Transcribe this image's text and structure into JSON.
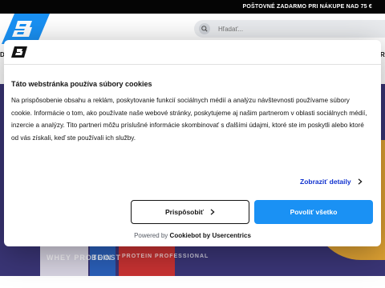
{
  "topbar": {
    "promo_text": "POŠTOVNÉ ZADARMO PRI NÁKUPE NAD 75 €"
  },
  "header": {
    "logo_alt": "B",
    "search": {
      "placeholder": "Hľadať..."
    },
    "nav_peek_left": "D",
    "nav_peek_right": "R"
  },
  "hero": {
    "product_labels": [
      "WHEY PROTEIN",
      "BOOST",
      "PROTEIN PROFESSIONAL"
    ]
  },
  "cookie_dialog": {
    "title": "Táto webstránka používa súbory cookies",
    "body": "Na prispôsobenie obsahu a reklám, poskytovanie funkcií sociálnych médií a analýzu návštevnosti používame súbory cookie. Informácie o tom, ako používate naše webové stránky, poskytujeme aj našim partnerom v oblasti sociálnych médií, inzercie a analýzy. Tito partneri môžu príslušné informácie skombinovať s ďalšími údajmi, ktoré ste im poskytli alebo ktoré od vás získali, keď ste používali ich služby.",
    "details_link": "Zobraziť detaily",
    "customize_button": "Prispôsobiť",
    "allow_all_button": "Povoliť všetko",
    "powered_prefix": "Powered by",
    "powered_brand": "Cookiebot by Usercentrics"
  },
  "colors": {
    "brand_blue": "#1a91f4",
    "link_blue": "#1032cf",
    "topbar_bg": "#050505",
    "hero_bg": "#3a3576"
  },
  "icons": [
    "brand-logo-icon",
    "search-icon",
    "chevron-right-icon"
  ]
}
